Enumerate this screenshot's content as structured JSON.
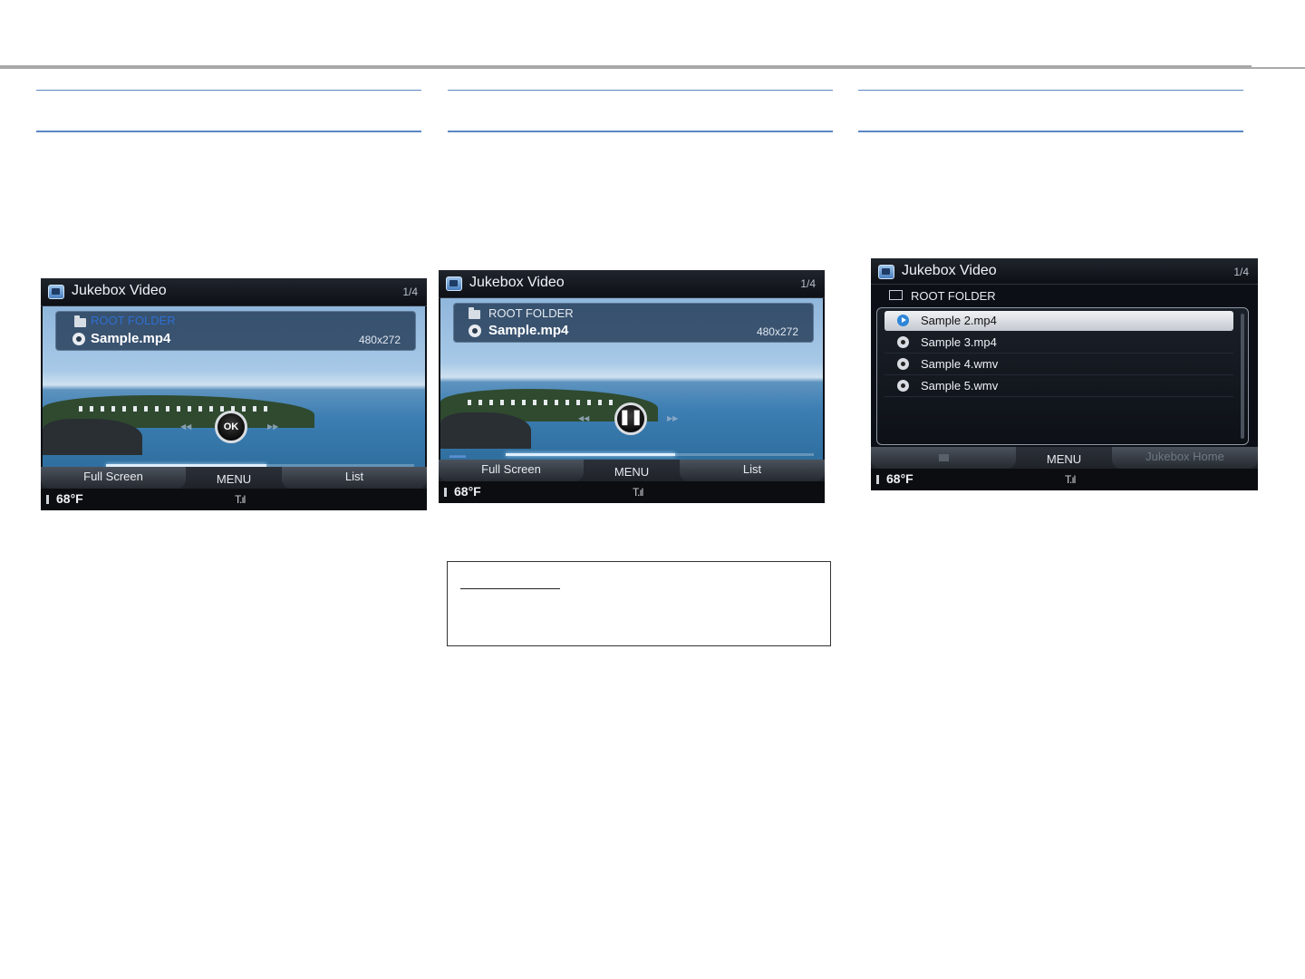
{
  "screens": [
    {
      "title": "Jukebox Video",
      "page_indicator": "1/4",
      "folder_name": "ROOT FOLDER",
      "file_name": "Sample.mp4",
      "resolution": "480x272",
      "center_button": "OK",
      "progress": 0.52,
      "tabs": {
        "left": "Full Screen",
        "center": "MENU",
        "right": "List"
      },
      "temperature": "68°F",
      "signal_icon": "signal-icon"
    },
    {
      "title": "Jukebox Video",
      "page_indicator": "1/4",
      "folder_name": "ROOT FOLDER",
      "file_name": "Sample.mp4",
      "resolution": "480x272",
      "center_button": "pause-icon",
      "progress": 0.55,
      "tabs": {
        "left": "Full Screen",
        "center": "MENU",
        "right": "List"
      },
      "temperature": "68°F",
      "signal_icon": "signal-icon"
    },
    {
      "title": "Jukebox Video",
      "page_indicator": "1/4",
      "folder_name": "ROOT FOLDER",
      "items": [
        {
          "name": "Sample 2.mp4",
          "selected": true,
          "icon": "play-icon"
        },
        {
          "name": "Sample 3.mp4",
          "selected": false,
          "icon": "video-file-icon"
        },
        {
          "name": "Sample 4.wmv",
          "selected": false,
          "icon": "video-file-icon"
        },
        {
          "name": "Sample 5.wmv",
          "selected": false,
          "icon": "video-file-icon"
        }
      ],
      "tabs": {
        "left": "",
        "center": "MENU",
        "right": "Jukebox Home"
      },
      "temperature": "68°F",
      "signal_icon": "signal-icon"
    }
  ],
  "colors": {
    "accent_blue": "#5b86c5",
    "rule_gray": "#a9a9a9",
    "folder_highlight": "#2f6fd1"
  }
}
